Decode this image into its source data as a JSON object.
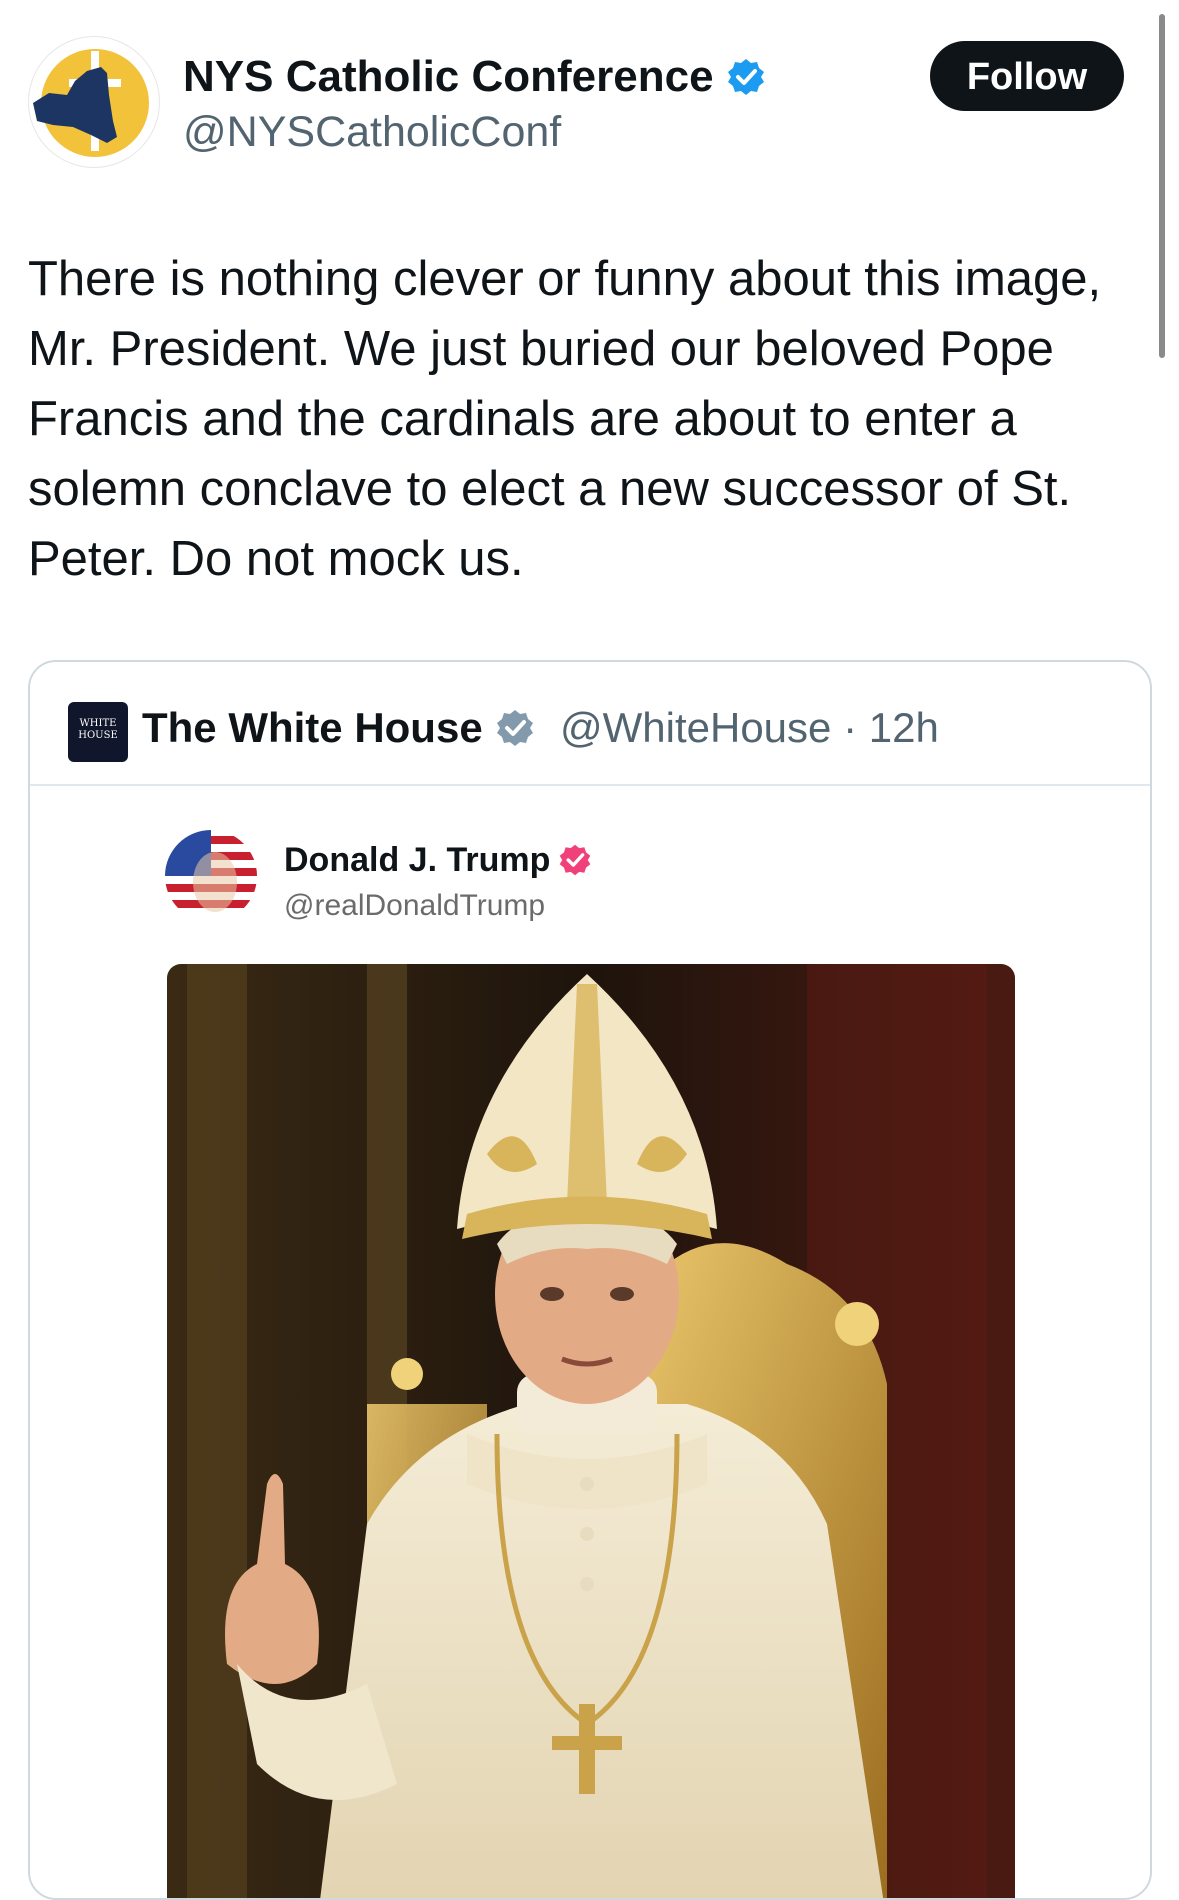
{
  "tweet": {
    "author_name": "NYS Catholic Conference",
    "author_handle": "@NYSCatholicConf",
    "follow_label": "Follow",
    "text": "There is nothing clever or funny about this image, Mr. President. We just buried our beloved Pope Francis and the cardinals are about to enter a solemn conclave to elect a new successor of St. Peter. Do not mock us.",
    "avatar_icon": "new-york-state-cross-icon",
    "verified_icon": "verified-badge-icon"
  },
  "quote": {
    "author_name": "The White House",
    "author_handle": "@WhiteHouse",
    "separator": "·",
    "time": "12h",
    "logo_icon": "white-house-logo",
    "logo_text": "The WHITE HOUSE",
    "verified_icon": "gray-verified-badge-icon",
    "embedded": {
      "author_name": "Donald J. Trump",
      "author_handle": "@realDonaldTrump",
      "badge_icon": "pink-verified-badge-icon",
      "image_icon": "pope-portrait-image"
    }
  },
  "colors": {
    "follow_bg": "#0f1419",
    "verified_blue": "#1d9bf0",
    "verified_gray": "#829aab",
    "badge_pink": "#f0417a",
    "handle_gray": "#536471",
    "card_border": "#cfd9de"
  }
}
